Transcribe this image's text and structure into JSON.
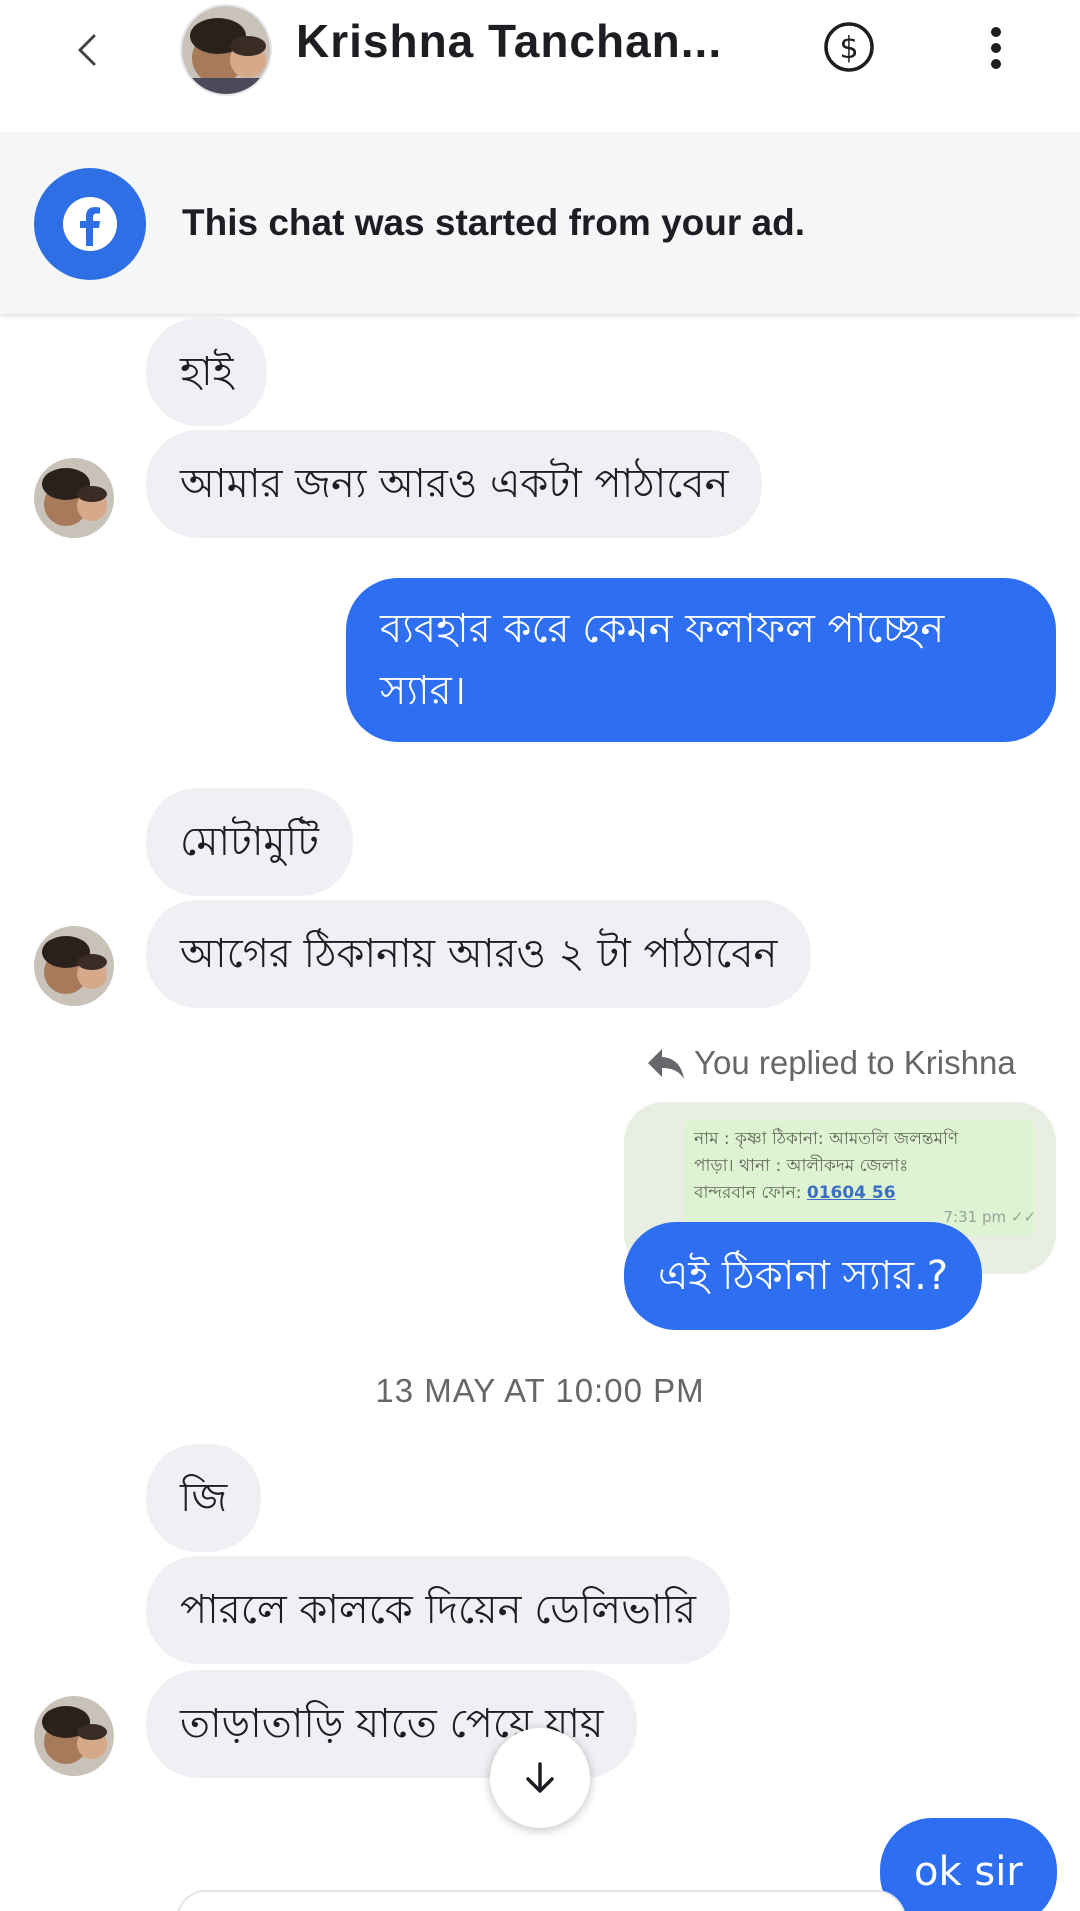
{
  "header": {
    "title": "Krishna Tanchan...",
    "back_icon": "chevron-left-icon",
    "payment_icon": "dollar-circle-icon",
    "more_icon": "more-vertical-icon"
  },
  "banner": {
    "icon": "facebook-icon",
    "text": "This chat was started from your ad."
  },
  "messages": [
    {
      "side": "in",
      "text": "হাই"
    },
    {
      "side": "in",
      "text": "আমার জন্য আরও একটা পাঠাবেন"
    },
    {
      "side": "out",
      "lines": [
        "ব্যবহার করে কেমন ফলাফল পাচ্ছেন",
        "স্যার।"
      ]
    },
    {
      "side": "in",
      "text": "মোটামুটি"
    },
    {
      "side": "in",
      "text": "আগের ঠিকানায় আরও  ২ টা পাঠাবেন"
    },
    {
      "side": "out",
      "text": "এই ঠিকানা স্যার.?"
    },
    {
      "side": "in",
      "text": "জি"
    },
    {
      "side": "in",
      "text": "পারলে কালকে দিয়েন ডেলিভারি"
    },
    {
      "side": "in",
      "text": "তাড়াতাড়ি  যাতে পেয়ে যায়"
    },
    {
      "side": "out",
      "text": "ok sir"
    }
  ],
  "reply": {
    "label": "You replied to Krishna",
    "quoted_lines": [
      "নাম : কৃষ্ণা  ঠিকানা:  আমতলি জলন্তমণি",
      "পাড়া। থানা : আলীকদম  জেলাঃ",
      "বান্দরবান  ফোন: "
    ],
    "quoted_phone": "01604     56",
    "quoted_time": "7:31 pm ✓✓"
  },
  "date_separator": "13 MAY AT 10:00 PM",
  "colors": {
    "outgoing": "#2e6ff2",
    "incoming": "#eff0f3",
    "facebook": "#2f6fe6"
  }
}
